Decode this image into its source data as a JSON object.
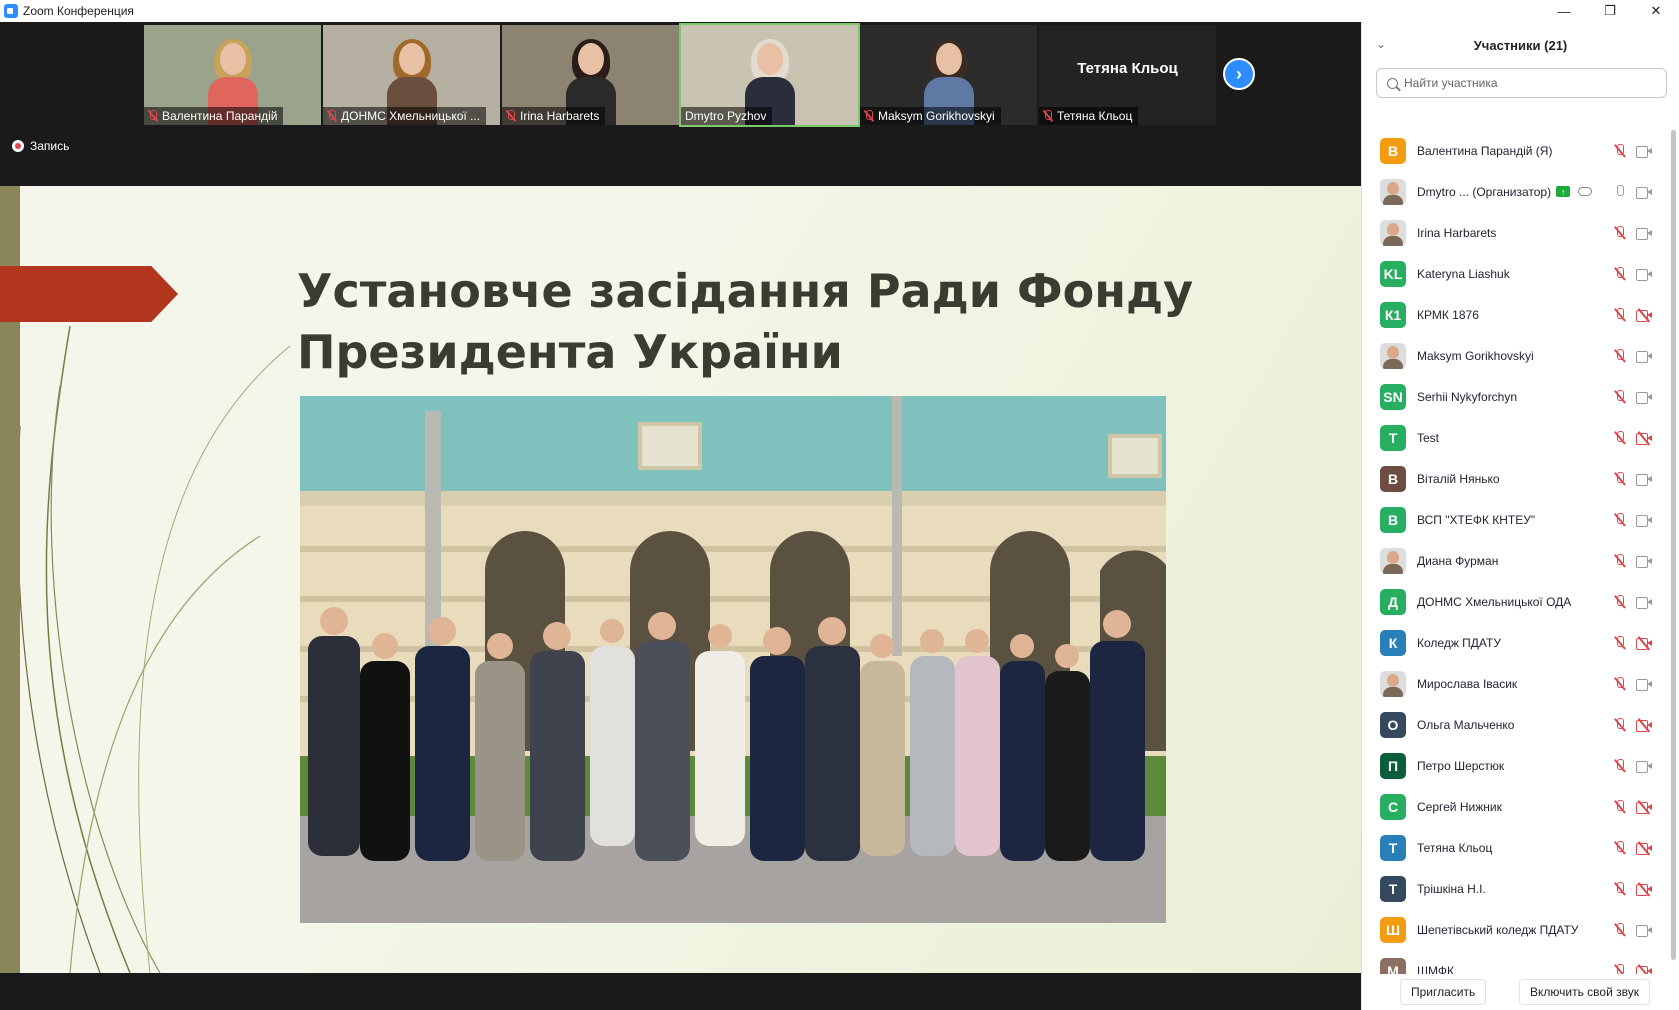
{
  "window": {
    "title": "Zoom Конференция",
    "controls": [
      "—",
      "❐",
      "✕"
    ]
  },
  "thumbnails": [
    {
      "name": "Валентина Парандій",
      "bg": "#9aa38b",
      "hair": "#c6a35a",
      "torso": "#e0655c",
      "muted": true
    },
    {
      "name": "ДОНМС Хмельницької ...",
      "bg": "#b6b0a3",
      "hair": "#a0692c",
      "torso": "#6b4e3d",
      "muted": true
    },
    {
      "name": "Irina Harbarets",
      "bg": "#8d8373",
      "hair": "#2a1c18",
      "torso": "#2a2a2a",
      "muted": true
    },
    {
      "name": "Dmytro Pyzhov",
      "bg": "#c9c4b2",
      "hair": "#e3dbd0",
      "torso": "#2a2e3a",
      "muted": false,
      "active": true
    },
    {
      "name": "Maksym Gorikhovskyi",
      "bg": "#2b2b2b",
      "hair": "#3a2c22",
      "torso": "#5e79a3",
      "muted": true
    },
    {
      "name": "Тетяна Кльоц",
      "muted": true,
      "text_only": true
    }
  ],
  "recording": {
    "label": "Запись"
  },
  "slide": {
    "title_line1": "Установче засідання Ради Фонду",
    "title_line2": "Президента України"
  },
  "panel": {
    "title": "Участники (21)",
    "search_placeholder": "Найти участника",
    "invite_label": "Пригласить",
    "unmute_label": "Включить свой звук",
    "participants": [
      {
        "name": "Валентина Парандій (Я)",
        "initials": "В",
        "color": "#f39c12",
        "cam_off": false
      },
      {
        "name": "Dmytro ... (Организатор)",
        "avatar": "photo",
        "host": true,
        "mic_on": true,
        "cam_off": false
      },
      {
        "name": "Irina Harbarets",
        "avatar": "photo",
        "cam_off": false
      },
      {
        "name": "Kateryna Liashuk",
        "initials": "KL",
        "color": "#27ae60",
        "cam_off": false
      },
      {
        "name": "КРМК 1876",
        "initials": "К1",
        "color": "#27ae60",
        "cam_off": true
      },
      {
        "name": "Maksym Gorikhovskyi",
        "avatar": "photo",
        "cam_off": false
      },
      {
        "name": "Serhii Nykyforchyn",
        "initials": "SN",
        "color": "#27ae60",
        "cam_off": false
      },
      {
        "name": "Test",
        "initials": "T",
        "color": "#27ae60",
        "cam_off": true
      },
      {
        "name": "Віталій Нянько",
        "initials": "В",
        "color": "#6d4c41",
        "cam_off": false
      },
      {
        "name": "ВСП \"ХТЕФК КНТЕУ\"",
        "initials": "В",
        "color": "#27ae60",
        "cam_off": false
      },
      {
        "name": "Диана Фурман",
        "avatar": "photo",
        "cam_off": false
      },
      {
        "name": "ДОНМС Хмельницької ОДА",
        "initials": "Д",
        "color": "#27ae60",
        "cam_off": false
      },
      {
        "name": "Коледж ПДАТУ",
        "initials": "К",
        "color": "#2980b9",
        "cam_off": true
      },
      {
        "name": "Мирослава Івасик",
        "avatar": "photo",
        "cam_off": false
      },
      {
        "name": "Ольга Мальченко",
        "initials": "О",
        "color": "#34495e",
        "cam_off": true
      },
      {
        "name": "Петро Шерстюк",
        "initials": "П",
        "color": "#0b5d3b",
        "cam_off": false
      },
      {
        "name": "Сергей Нижник",
        "initials": "С",
        "color": "#27ae60",
        "cam_off": true
      },
      {
        "name": "Тетяна Кльоц",
        "initials": "Т",
        "color": "#2980b9",
        "cam_off": true
      },
      {
        "name": "Трішкіна Н.І.",
        "initials": "Т",
        "color": "#34495e",
        "cam_off": true
      },
      {
        "name": "Шепетівський коледж ПДАТУ",
        "initials": "Ш",
        "color": "#f39c12",
        "cam_off": false
      },
      {
        "name": "ШМФК",
        "initials": "М",
        "color": "#8d6e63",
        "cam_off": true
      }
    ]
  }
}
